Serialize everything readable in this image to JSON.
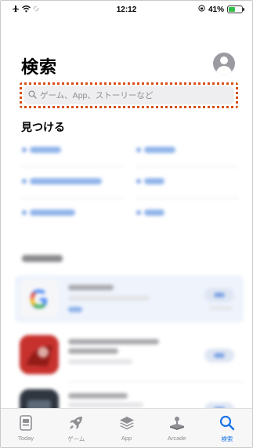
{
  "status_bar": {
    "time": "12:12",
    "battery": "41%"
  },
  "header": {
    "title": "検索"
  },
  "search": {
    "placeholder": "ゲーム、App、ストーリーなど"
  },
  "sections": {
    "discover": "見つける"
  },
  "tabs": [
    {
      "label": "Today",
      "icon": "today-icon",
      "active": false
    },
    {
      "label": "ゲーム",
      "icon": "rocket-icon",
      "active": false
    },
    {
      "label": "App",
      "icon": "layers-icon",
      "active": false
    },
    {
      "label": "Arcade",
      "icon": "joystick-icon",
      "active": false
    },
    {
      "label": "検索",
      "icon": "search-icon",
      "active": true
    }
  ],
  "colors": {
    "accent": "#1a73e8",
    "search_highlight": "#d94e15",
    "green_battery": "#30c04a"
  }
}
